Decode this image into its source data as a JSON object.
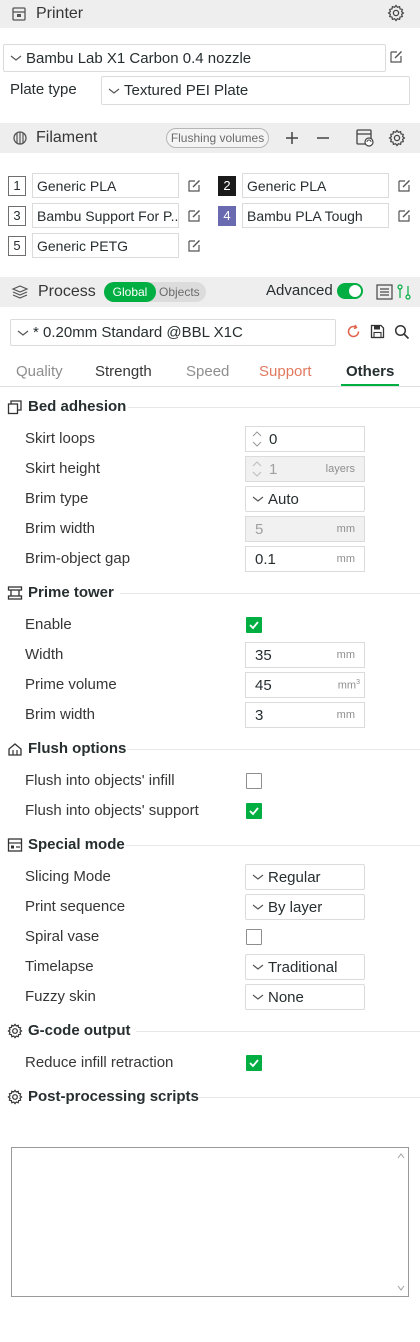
{
  "printer": {
    "title": "Printer",
    "preset": "Bambu Lab X1 Carbon 0.4 nozzle",
    "plate_label": "Plate type",
    "plate_value": "Textured PEI Plate"
  },
  "filament": {
    "title": "Filament",
    "flushing_button": "Flushing volumes",
    "items": [
      {
        "num": "1",
        "name": "Generic PLA",
        "color": "#ffffff",
        "num_color": "#262e30"
      },
      {
        "num": "2",
        "name": "Generic PLA",
        "color": "#1a1a1a",
        "num_color": "#ffffff"
      },
      {
        "num": "3",
        "name": "Bambu Support For P...",
        "color": "#ffffff",
        "num_color": "#262e30"
      },
      {
        "num": "4",
        "name": "Bambu PLA Tough",
        "color": "#6a6ab0",
        "num_color": "#ffffff"
      },
      {
        "num": "5",
        "name": "Generic PETG",
        "color": "#ffffff",
        "num_color": "#262e30"
      }
    ]
  },
  "process": {
    "title": "Process",
    "toggle_global": "Global",
    "toggle_objects": "Objects",
    "advanced_label": "Advanced",
    "advanced_on": true,
    "preset": "* 0.20mm Standard @BBL X1C",
    "accent": "#00ae42"
  },
  "tabs": [
    "Quality",
    "Strength",
    "Speed",
    "Support",
    "Others"
  ],
  "active_tab": "Others",
  "bed_adhesion": {
    "title": "Bed adhesion",
    "skirt_loops": {
      "label": "Skirt loops",
      "value": "0"
    },
    "skirt_height": {
      "label": "Skirt height",
      "value": "1",
      "unit": "layers"
    },
    "brim_type": {
      "label": "Brim type",
      "value": "Auto"
    },
    "brim_width": {
      "label": "Brim width",
      "value": "5",
      "unit": "mm"
    },
    "brim_gap": {
      "label": "Brim-object gap",
      "value": "0.1",
      "unit": "mm"
    }
  },
  "prime_tower": {
    "title": "Prime tower",
    "enable": {
      "label": "Enable",
      "checked": true
    },
    "width": {
      "label": "Width",
      "value": "35",
      "unit": "mm"
    },
    "volume": {
      "label": "Prime volume",
      "value": "45",
      "unit": "mm",
      "unit_sup": "3"
    },
    "brim_width": {
      "label": "Brim width",
      "value": "3",
      "unit": "mm"
    }
  },
  "flush": {
    "title": "Flush options",
    "infill": {
      "label": "Flush into objects' infill",
      "checked": false
    },
    "support": {
      "label": "Flush into objects' support",
      "checked": true
    }
  },
  "special": {
    "title": "Special mode",
    "slicing": {
      "label": "Slicing Mode",
      "value": "Regular"
    },
    "sequence": {
      "label": "Print sequence",
      "value": "By layer"
    },
    "spiral": {
      "label": "Spiral vase",
      "checked": false
    },
    "timelapse": {
      "label": "Timelapse",
      "value": "Traditional"
    },
    "fuzzy": {
      "label": "Fuzzy skin",
      "value": "None"
    }
  },
  "gcode": {
    "title": "G-code output",
    "reduce": {
      "label": "Reduce infill retraction",
      "checked": true
    }
  },
  "post": {
    "title": "Post-processing scripts",
    "text": ""
  }
}
